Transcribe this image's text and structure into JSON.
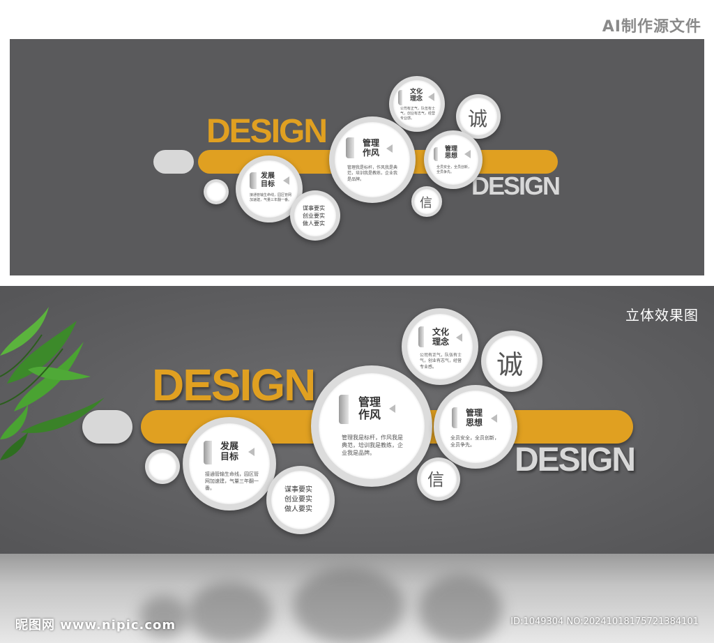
{
  "header": {
    "title": "AI制作源文件"
  },
  "design": {
    "big": "DESIGN",
    "small": "DESIGN"
  },
  "circles": {
    "culture": {
      "title1": "文化",
      "title2": "理念",
      "body": "公司有正气，队伍有士气，创业有志气，经营专业感。"
    },
    "management": {
      "title1": "管理",
      "title2": "作风",
      "body": "管理我是标杆，作风我是典范，培训我是教练，企业我是品牌。"
    },
    "thought": {
      "title1": "管理",
      "title2": "思想",
      "body": "全员安全，全员创新，全员争先。"
    },
    "goal": {
      "title1": "发展",
      "title2": "目标",
      "body": "接通管输生命线，园区管网加速建，气量三年翻一番。"
    },
    "motto": {
      "line1": "谋事要实",
      "line2": "创业要实",
      "line3": "做人要实"
    },
    "honesty": {
      "char": "诚"
    },
    "trust": {
      "char": "信"
    }
  },
  "bottom": {
    "label": "立体效果图"
  },
  "footer": {
    "logo": "昵图网 www.nipic.com",
    "id": "ID:1049304 NO:20241018175721384101"
  },
  "colors": {
    "accent": "#e0a021",
    "panel": "#5a5a5c",
    "circle": "#dcdcdc"
  }
}
